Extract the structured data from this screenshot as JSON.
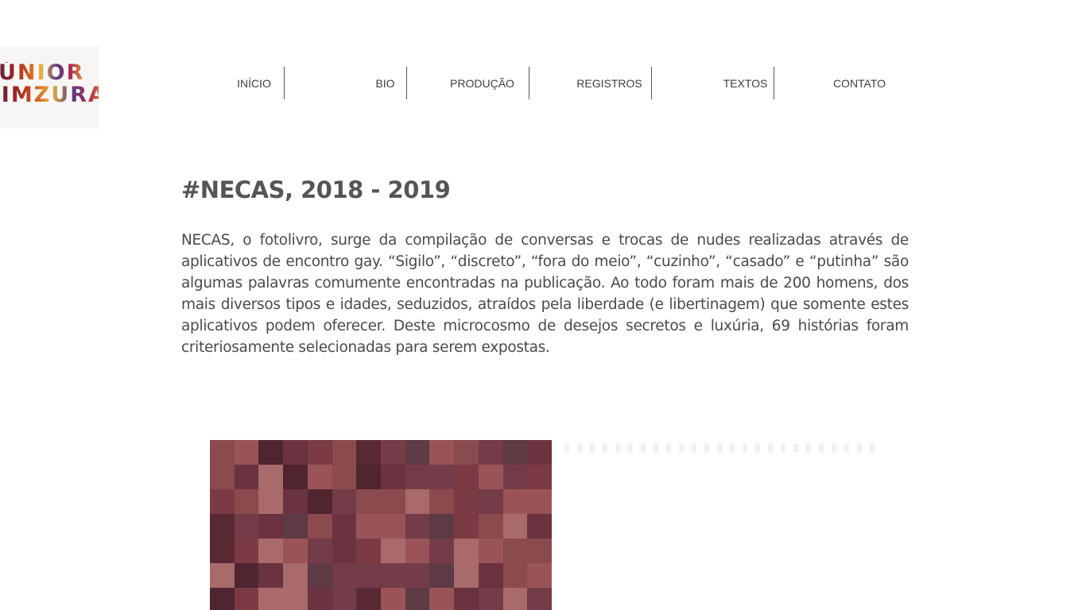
{
  "logo": {
    "line1": "JÚNIOR",
    "line2": "PIMZURA"
  },
  "nav": {
    "items": [
      {
        "label": "INÍCIO"
      },
      {
        "label": "BIO"
      },
      {
        "label": "PRODUÇÃO"
      },
      {
        "label": "REGISTROS"
      },
      {
        "label": "TEXTOS"
      },
      {
        "label": "CONTATO"
      }
    ]
  },
  "main": {
    "title": "#NECAS, 2018 - 2019",
    "body": "NECAS, o fotolivro, surge da compilação de conversas e trocas de nudes realizadas através de aplicativos de encontro gay. “Sigilo”, “discreto”, “fora do meio”, “cuzinho”, “casado” e “putinha” são algumas palavras comumente encontradas na publicação. Ao todo foram mais de 200 homens, dos mais diversos tipos e idades, seduzidos, atraídos pela liberdade (e libertinagem) que somente estes aplicativos podem oferecer. Deste microcosmo de desejos secretos e luxúria, 69 histórias foram criteriosamente selecionadas para serem expostas."
  },
  "colors": {
    "title": "#555555",
    "text": "#4a4a4a",
    "nav_text": "#3d3d3d",
    "divider": "#555555",
    "photo_palette": [
      "#5a2a34",
      "#4f2530",
      "#6b3340",
      "#7a3b45",
      "#8a4a4e",
      "#9a5458",
      "#a86a6a",
      "#5e3a44",
      "#743c48"
    ]
  }
}
